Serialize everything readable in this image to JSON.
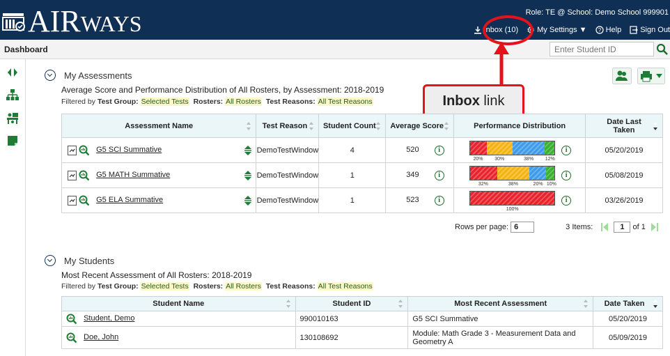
{
  "app": {
    "logo_text_big": "AIR",
    "logo_text_small": "WAYS"
  },
  "header": {
    "role": "Role: TE @ School: Demo School 999901",
    "inbox": "Inbox (10)",
    "settings": "My Settings ▼",
    "help": "Help",
    "signout": "Sign Out"
  },
  "subbar": {
    "title": "Dashboard",
    "student_id_placeholder": "Enter Student ID"
  },
  "callout": {
    "bold": "Inbox",
    "rest": " link"
  },
  "assessments": {
    "title": "My Assessments",
    "subtitle": "Average Score and Performance Distribution of All Rosters, by Assessment: 2018-2019",
    "filter": {
      "prefix": "Filtered by",
      "tg_label": "Test Group:",
      "tg_value": "Selected Tests",
      "ro_label": "Rosters:",
      "ro_value": "All Rosters",
      "tr_label": "Test Reasons:",
      "tr_value": "All Test Reasons"
    },
    "columns": [
      "Assessment Name",
      "Test Reason",
      "Student Count",
      "Average Score",
      "Performance Distribution",
      "Date Last Taken"
    ],
    "rows": [
      {
        "name": "G5 SCI Summative",
        "reason": "DemoTestWindow",
        "count": "4",
        "avg": "520",
        "date": "05/20/2019",
        "dist": [
          {
            "p": 20,
            "c": "#e8212a",
            "label": "20%"
          },
          {
            "p": 30,
            "c": "#f5b312",
            "label": "30%"
          },
          {
            "p": 38,
            "c": "#3d9be9",
            "label": "38%"
          },
          {
            "p": 12,
            "c": "#38b12f",
            "label": "12%"
          }
        ]
      },
      {
        "name": "G5 MATH Summative",
        "reason": "DemoTestWindow",
        "count": "1",
        "avg": "349",
        "date": "05/08/2019",
        "dist": [
          {
            "p": 32,
            "c": "#e8212a",
            "label": "32%"
          },
          {
            "p": 38,
            "c": "#f5b312",
            "label": "38%"
          },
          {
            "p": 20,
            "c": "#3d9be9",
            "label": "20%"
          },
          {
            "p": 10,
            "c": "#38b12f",
            "label": "10%"
          }
        ]
      },
      {
        "name": "G5 ELA Summative",
        "reason": "DemoTestWindow",
        "count": "1",
        "avg": "523",
        "date": "03/26/2019",
        "dist": [
          {
            "p": 100,
            "c": "#e8212a",
            "label": "100%"
          }
        ]
      }
    ],
    "pager": {
      "rows_label": "Rows per page:",
      "rows_value": "6",
      "items": "3 Items:",
      "page": "1",
      "of": "of 1"
    }
  },
  "students": {
    "title": "My Students",
    "subtitle": "Most Recent Assessment of All Rosters: 2018-2019",
    "filter": {
      "prefix": "Filtered by",
      "tg_label": "Test Group:",
      "tg_value": "Selected Tests",
      "ro_label": "Rosters:",
      "ro_value": "All Rosters",
      "tr_label": "Test Reasons:",
      "tr_value": "All Test Reasons"
    },
    "columns": [
      "Student Name",
      "Student ID",
      "Most Recent Assessment",
      "Date Taken"
    ],
    "rows": [
      {
        "name": "Student, Demo",
        "id": "990010163",
        "assessment": "G5 SCI Summative",
        "date": "05/20/2019"
      },
      {
        "name": "Doe, John",
        "id": "130108692",
        "assessment": "Module: Math Grade 3 - Measurement Data and Geometry A",
        "date": "05/09/2019"
      }
    ]
  }
}
